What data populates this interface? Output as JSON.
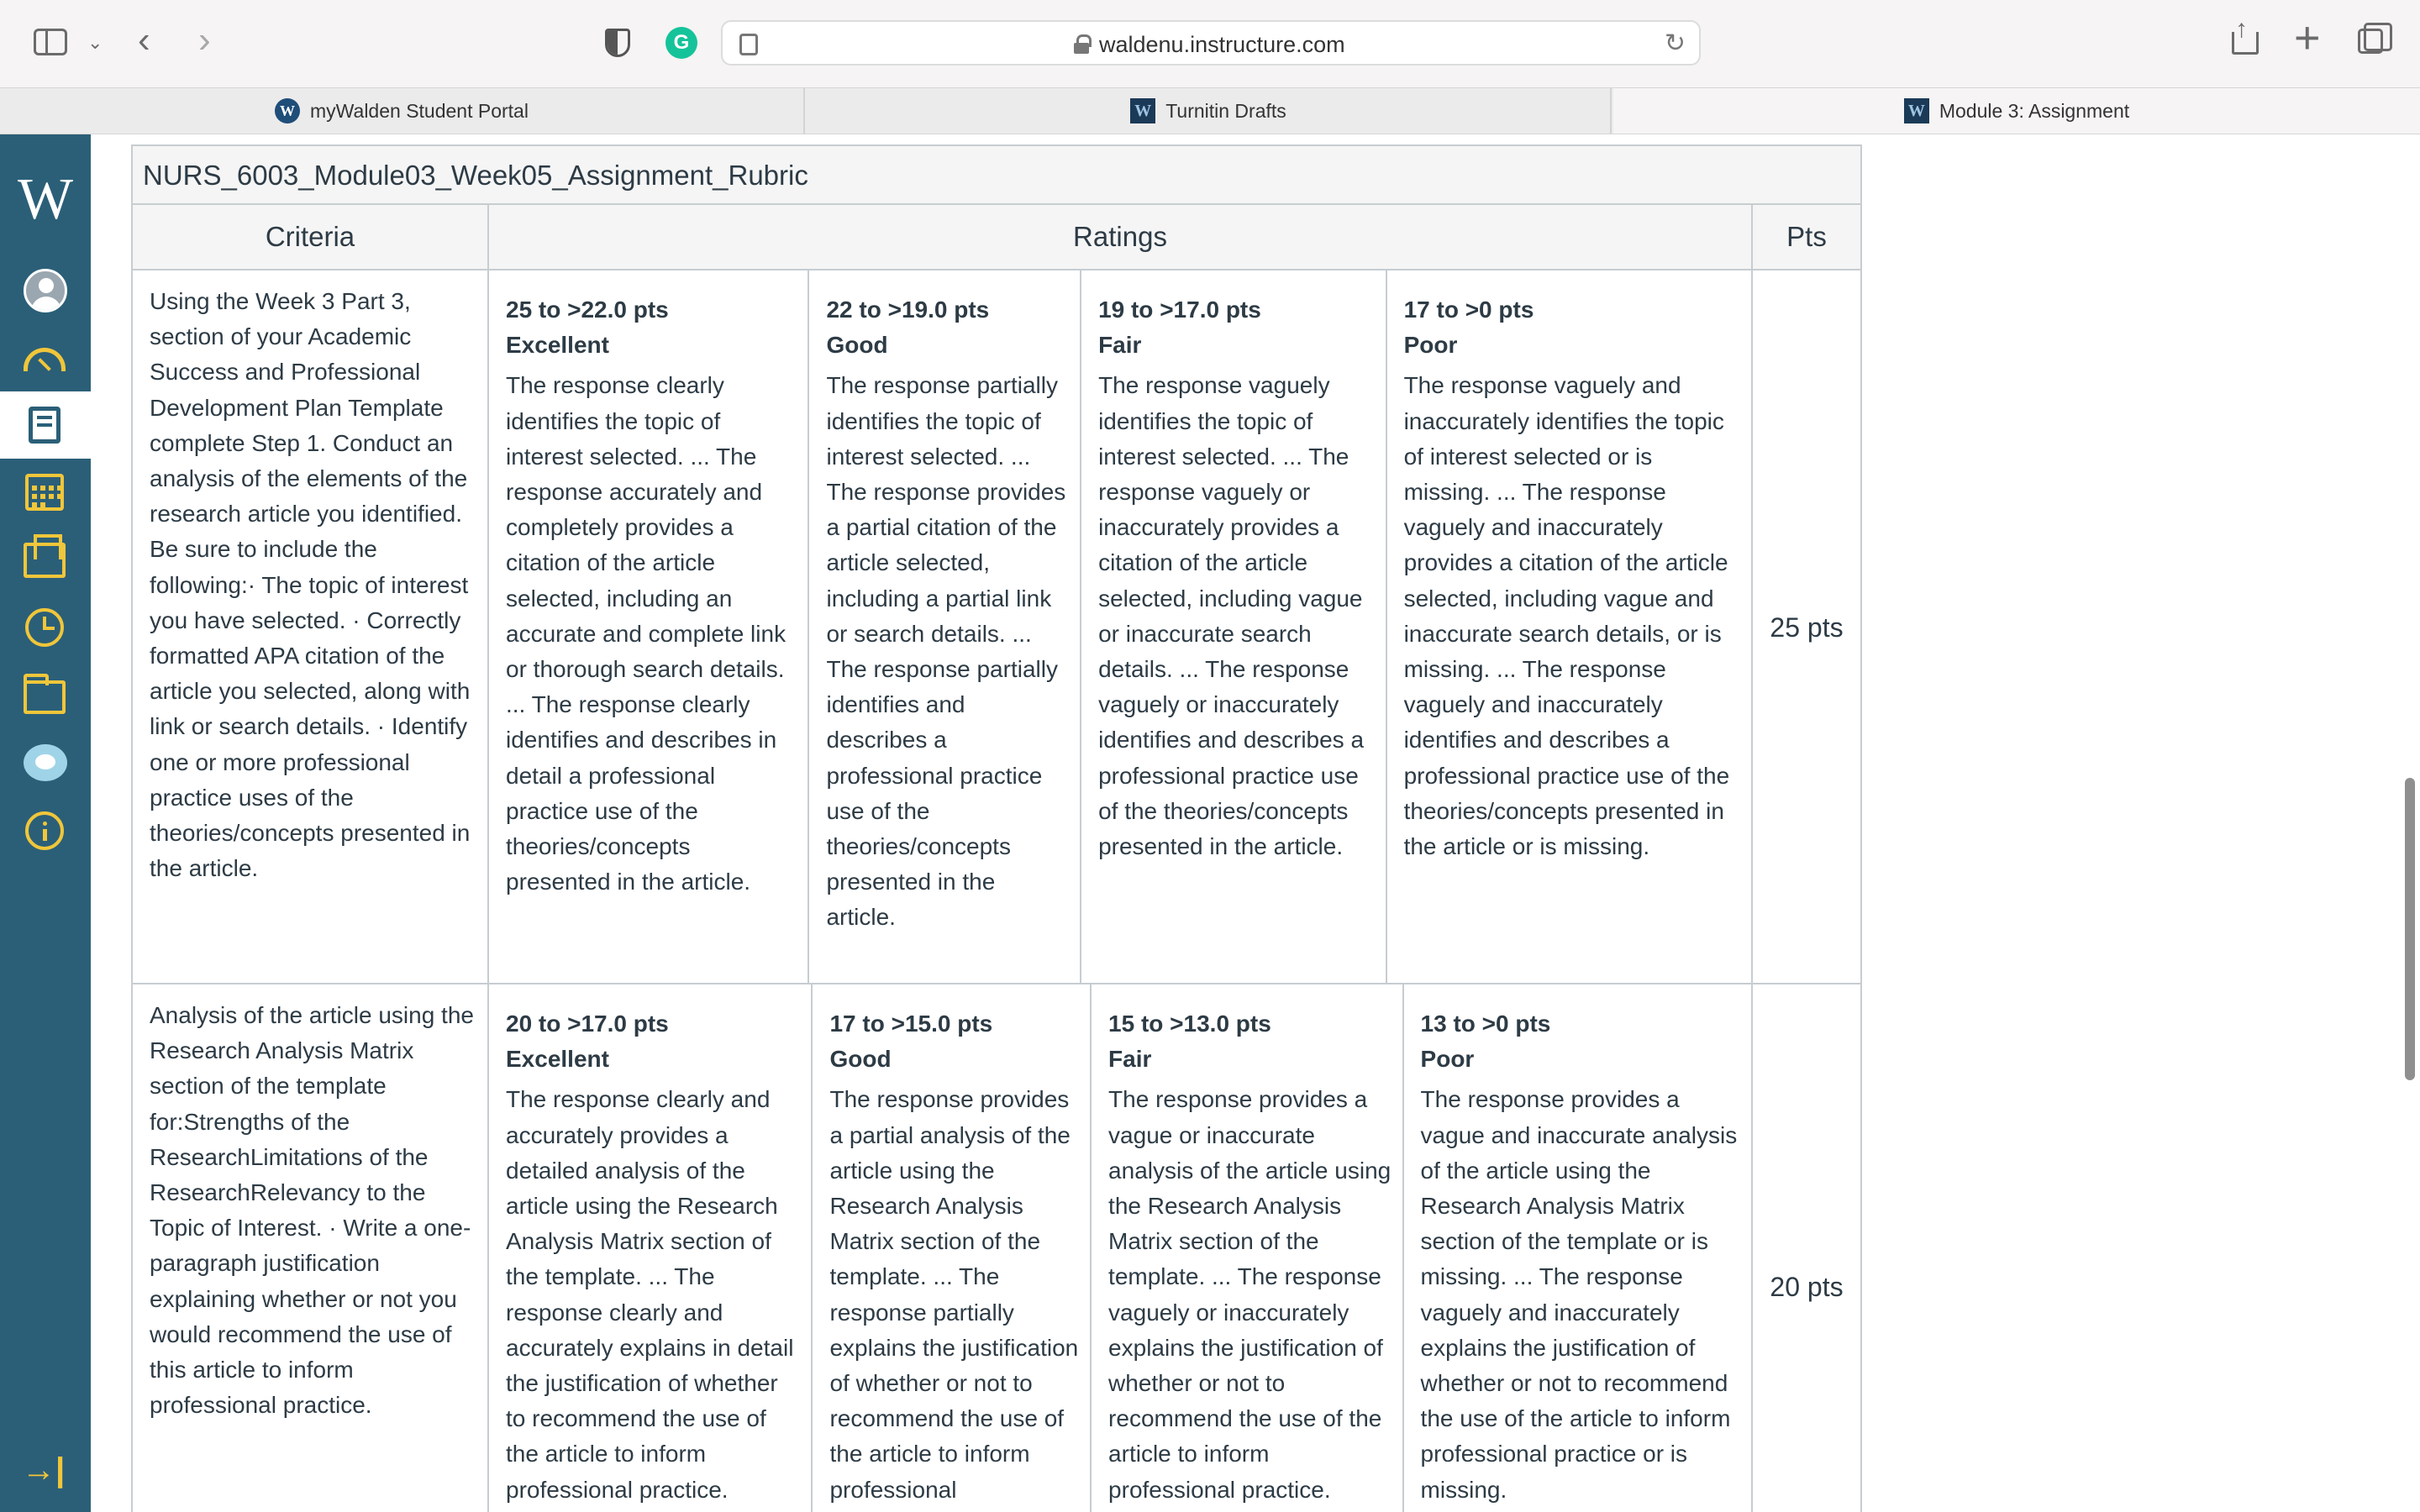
{
  "browser": {
    "url": "waldenu.instructure.com",
    "tabs": [
      {
        "label": "myWalden Student Portal",
        "favicon": "W"
      },
      {
        "label": "Turnitin Drafts",
        "favicon": "W"
      },
      {
        "label": "Module 3: Assignment",
        "favicon": "W"
      }
    ],
    "grammarly_letter": "G"
  },
  "nav": {
    "logo": "W",
    "items": [
      "account-icon",
      "dashboard-icon",
      "courses-icon",
      "calendar-icon",
      "inbox-icon",
      "history-icon",
      "files-icon",
      "chat-icon",
      "help-icon"
    ],
    "collapse_glyph": "→|",
    "colors": {
      "background": "#2b5f78",
      "icon": "#f0c63a"
    }
  },
  "rubric": {
    "title": "NURS_6003_Module03_Week05_Assignment_Rubric",
    "headers": {
      "criteria": "Criteria",
      "ratings": "Ratings",
      "pts": "Pts"
    },
    "rows": [
      {
        "criterion": "Using the Week 3 Part 3, section of your Academic Success and Professional Development Plan Template complete Step 1. Conduct an analysis of the elements of the research article you identified. Be sure to include the following:· The topic of interest you have selected. · Correctly formatted APA citation of the article you selected, along with link or search details. · Identify one or more professional practice uses of the theories/concepts presented in the article.",
        "ratings": [
          {
            "pts": "25 to >22.0 pts",
            "name": "Excellent",
            "desc": "The response clearly identifies the topic of interest selected. ... The response accurately and completely provides a citation of the article selected, including an accurate and complete link or thorough search details. ... The response clearly identifies and describes in detail a professional practice use of the theories/concepts presented in the article."
          },
          {
            "pts": "22 to >19.0 pts",
            "name": "Good",
            "desc": "The response partially identifies the topic of interest selected. ... The response provides a partial citation of the article selected, including a partial link or search details. ... The response partially identifies and describes a professional practice use of the theories/concepts presented in the article."
          },
          {
            "pts": "19 to >17.0 pts",
            "name": "Fair",
            "desc": "The response vaguely identifies the topic of interest selected. ... The response vaguely or inaccurately provides a citation of the article selected, including vague or inaccurate search details. ... The response vaguely or inaccurately identifies and describes a professional practice use of the theories/concepts presented in the article."
          },
          {
            "pts": "17 to >0 pts",
            "name": "Poor",
            "desc": "The response vaguely and inaccurately identifies the topic of interest selected or is missing. ... The response vaguely and inaccurately provides a citation of the article selected, including vague and inaccurate search details, or is missing. ... The response vaguely and inaccurately identifies and describes a professional practice use of the theories/concepts presented in the article or is missing."
          }
        ],
        "points": "25 pts"
      },
      {
        "criterion": "Analysis of the article using the Research Analysis Matrix section of the template for:Strengths of the ResearchLimitations of the ResearchRelevancy to the Topic of Interest. · Write a one-paragraph justification explaining whether or not you would recommend the use of this article to inform professional practice.",
        "ratings": [
          {
            "pts": "20 to >17.0 pts",
            "name": "Excellent",
            "desc": "The response clearly and accurately provides a detailed analysis of the article using the Research Analysis Matrix section of the template. ... The response clearly and accurately explains in detail the justification of whether to recommend the use of the article to inform professional practice."
          },
          {
            "pts": "17 to >15.0 pts",
            "name": "Good",
            "desc": "The response provides a partial analysis of the article using the Research Analysis Matrix section of the template. ... The response partially explains the justification of whether or not to recommend the use of the article to inform professional"
          },
          {
            "pts": "15 to >13.0 pts",
            "name": "Fair",
            "desc": "The response provides a vague or inaccurate analysis of the article using the Research Analysis Matrix section of the template. ... The response vaguely or inaccurately explains the justification of whether or not to recommend the use of the article to inform professional practice."
          },
          {
            "pts": "13 to >0 pts",
            "name": "Poor",
            "desc": "The response provides a vague and inaccurate analysis of the article using the Research Analysis Matrix section of the template or is missing. ... The response vaguely and inaccurately explains the justification of whether or not to recommend the use of the article to inform professional practice or is missing."
          }
        ],
        "points": "20 pts"
      }
    ]
  }
}
